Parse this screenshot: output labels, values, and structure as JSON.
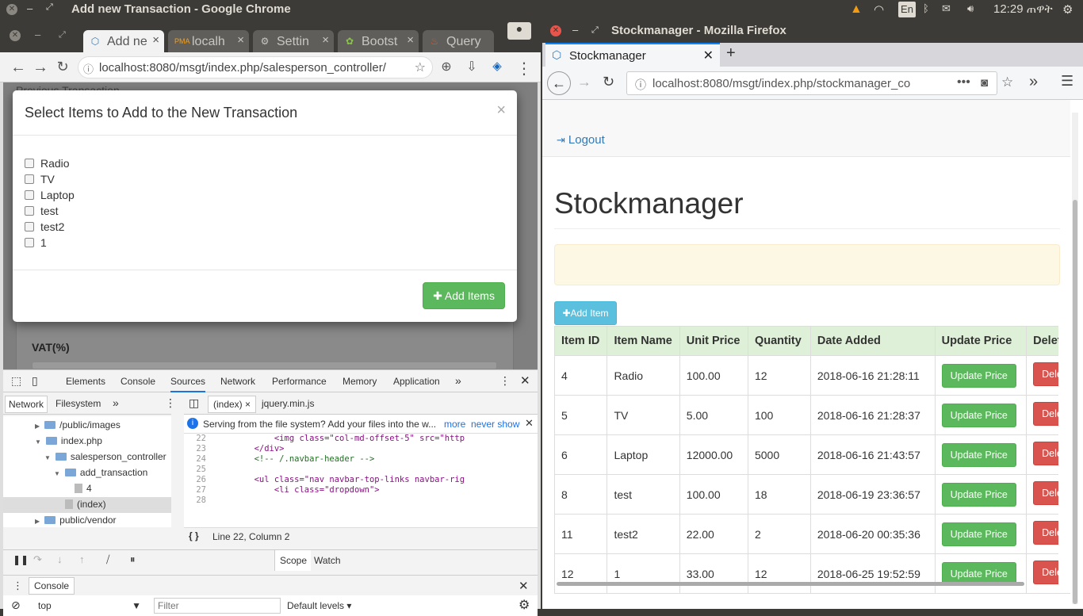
{
  "topbar": {
    "window_title": "Add new Transaction - Google Chrome",
    "keyboard": "En",
    "clock": "12:29 ጠዋት"
  },
  "chrome": {
    "tabs": [
      {
        "label": "Add ne",
        "icon": "bootstrap-icon"
      },
      {
        "label": "localh",
        "icon": "phpmyadmin-icon"
      },
      {
        "label": "Settin",
        "icon": "gear-icon"
      },
      {
        "label": "Bootst",
        "icon": "bootsnipp-icon"
      },
      {
        "label": "Query",
        "icon": "codeigniter-icon"
      }
    ],
    "url": "localhost:8080/msgt/index.php/salesperson_controller/",
    "behind_text": "Previous Transaction",
    "modal": {
      "title": "Select Items to Add to the New Transaction",
      "items": [
        "Radio",
        "TV",
        "Laptop",
        "test",
        "test2",
        "1"
      ],
      "add_button": "✚ Add Items"
    },
    "vat_label": "VAT(%)"
  },
  "devtools": {
    "tabs": [
      "Elements",
      "Console",
      "Sources",
      "Network",
      "Performance",
      "Memory",
      "Application"
    ],
    "active_tab": "Sources",
    "nav_tabs": [
      "Network",
      "Filesystem"
    ],
    "tree": [
      {
        "label": "/public/images",
        "kind": "folder",
        "level": 1
      },
      {
        "label": "index.php",
        "kind": "folder",
        "level": 1
      },
      {
        "label": "salesperson_controller",
        "kind": "folder",
        "level": 2
      },
      {
        "label": "add_transaction",
        "kind": "folder",
        "level": 3
      },
      {
        "label": "4",
        "kind": "file",
        "level": 4
      },
      {
        "label": "(index)",
        "kind": "file",
        "level": 3
      },
      {
        "label": "public/vendor",
        "kind": "folder",
        "level": 1
      }
    ],
    "file_tabs": [
      "(index)",
      "jquery.min.js"
    ],
    "info": "Serving from the file system? Add your files into the w...",
    "info_more": "more",
    "info_never": "never show",
    "code_lines": [
      {
        "n": "22",
        "t": "            <img class=\"col-md-offset-5\" src=\"http"
      },
      {
        "n": "23",
        "t": "        </div>"
      },
      {
        "n": "24",
        "t": "        <!-- /.navbar-header -->"
      },
      {
        "n": "25",
        "t": ""
      },
      {
        "n": "26",
        "t": "        <ul class=\"nav navbar-top-links navbar-rig"
      },
      {
        "n": "27",
        "t": "            <li class=\"dropdown\">"
      },
      {
        "n": "28",
        "t": ""
      }
    ],
    "status": "Line 22, Column 2",
    "scope_tabs": [
      "Scope",
      "Watch"
    ],
    "console_label": "Console",
    "context": "top",
    "filter_placeholder": "Filter",
    "levels": "Default levels"
  },
  "firefox": {
    "window_title": "Stockmanager - Mozilla Firefox",
    "tab_label": "Stockmanager",
    "url": "localhost:8080/msgt/index.php/stockmanager_co",
    "logout": "Logout",
    "heading": "Stockmanager",
    "add_item": "✚Add Item",
    "table": {
      "headers": [
        "Item ID",
        "Item Name",
        "Unit Price",
        "Quantity",
        "Date Added",
        "Update Price",
        "Delete"
      ],
      "rows": [
        [
          "4",
          "Radio",
          "100.00",
          "12",
          "2018-06-16 21:28:11"
        ],
        [
          "5",
          "TV",
          "5.00",
          "100",
          "2018-06-16 21:28:37"
        ],
        [
          "6",
          "Laptop",
          "12000.00",
          "5000",
          "2018-06-16 21:43:57"
        ],
        [
          "8",
          "test",
          "100.00",
          "18",
          "2018-06-19 23:36:57"
        ],
        [
          "11",
          "test2",
          "22.00",
          "2",
          "2018-06-20 00:35:36"
        ],
        [
          "12",
          "1",
          "33.00",
          "12",
          "2018-06-25 19:52:59"
        ]
      ],
      "update_label": "Update Price",
      "delete_label": "Delete It"
    }
  }
}
